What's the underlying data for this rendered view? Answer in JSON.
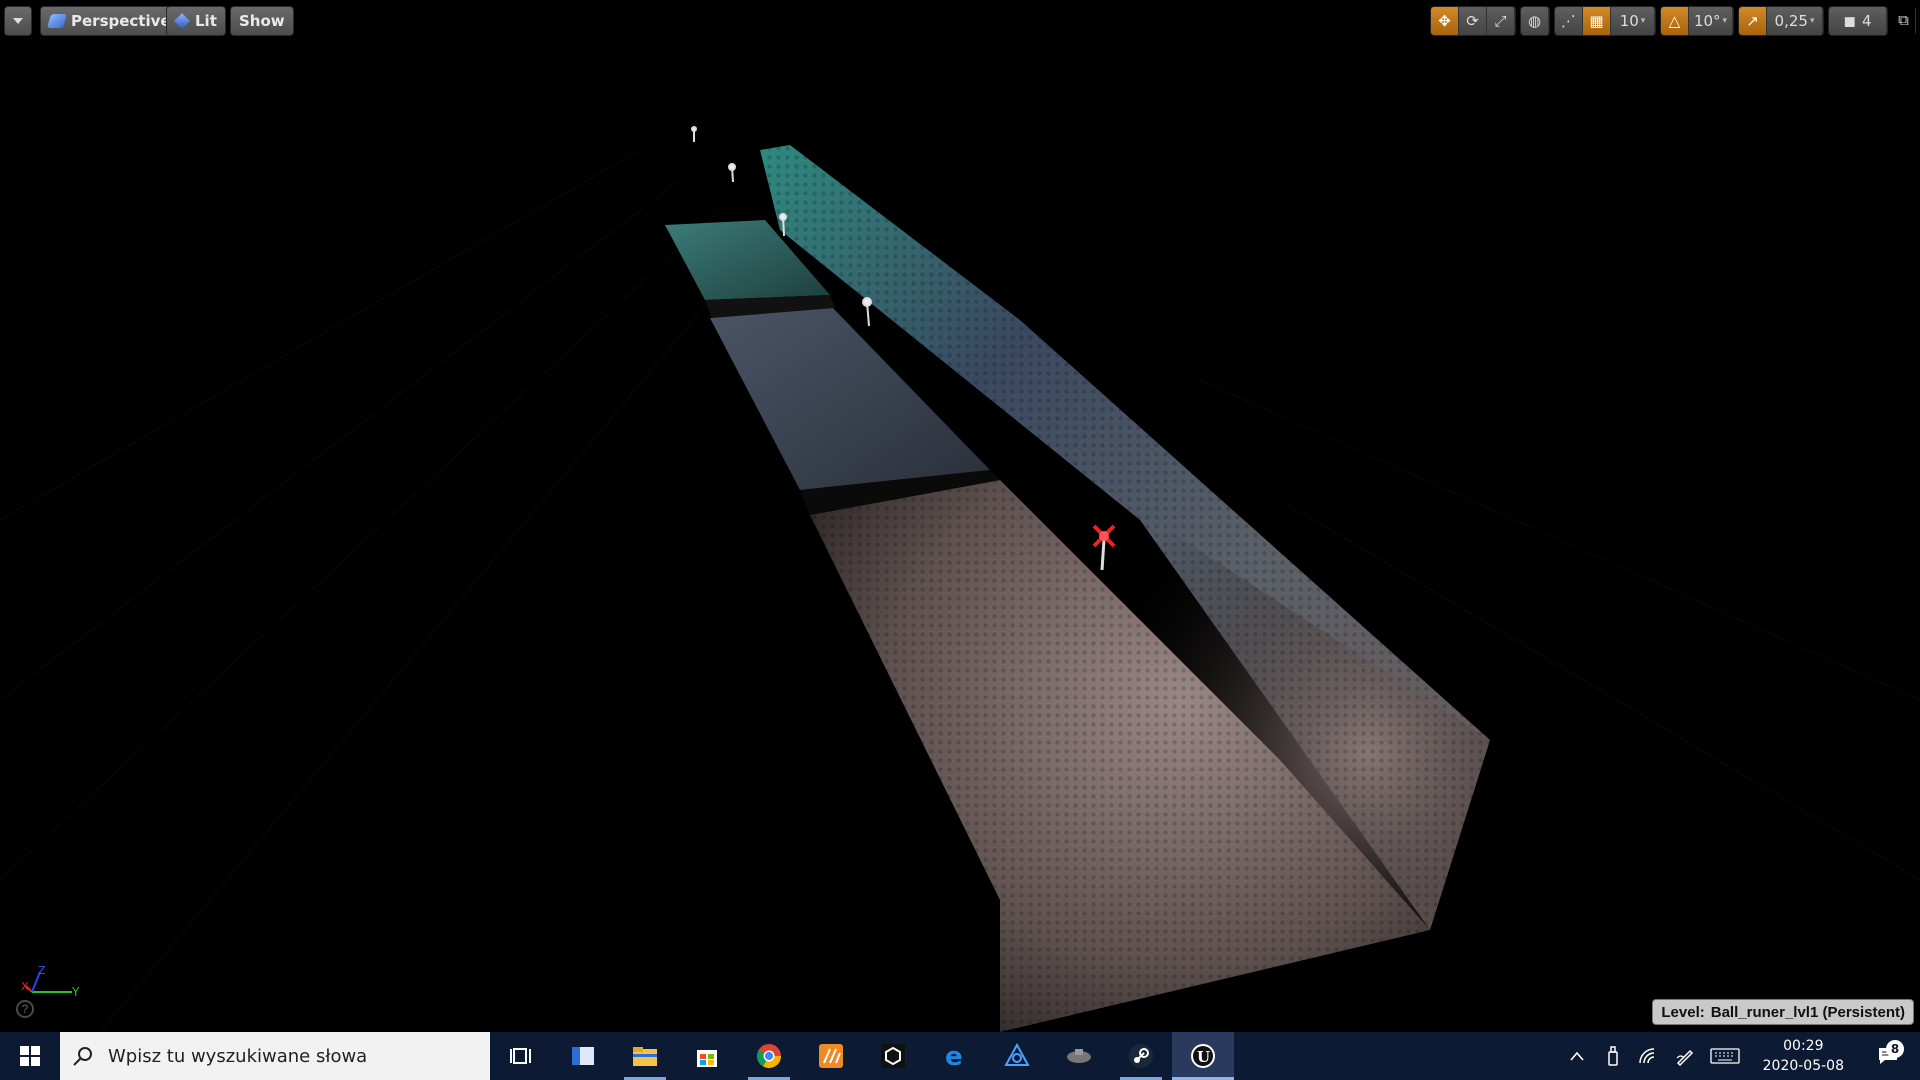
{
  "toolbar_left": {
    "menu_icon": "chevron-down-icon",
    "perspective_label": "Perspective",
    "lit_label": "Lit",
    "show_label": "Show"
  },
  "toolbar_right": {
    "grid_snap_value": "10",
    "rotation_snap_value": "10°",
    "scale_snap_value": "0,25",
    "camera_speed_value": "4"
  },
  "level": {
    "prefix": "Level:",
    "name": "Ball_runer_lvl1 (Persistent)"
  },
  "gizmo": {
    "z_label": "Z",
    "x_label": "X",
    "y_label": "Y",
    "help_glyph": "?"
  },
  "taskbar": {
    "search_placeholder": "Wpisz tu wyszukiwane słowa",
    "apps": [
      {
        "name": "task-view",
        "running": false
      },
      {
        "name": "app-window",
        "running": false
      },
      {
        "name": "file-explorer",
        "running": true
      },
      {
        "name": "microsoft-store",
        "running": false
      },
      {
        "name": "chrome",
        "running": true
      },
      {
        "name": "substance-app",
        "running": false
      },
      {
        "name": "unity",
        "running": false
      },
      {
        "name": "edge",
        "running": false
      },
      {
        "name": "blender-like-app",
        "running": false
      },
      {
        "name": "game-app",
        "running": false
      },
      {
        "name": "steam",
        "running": true
      },
      {
        "name": "unreal-engine",
        "running": true,
        "active": true
      }
    ],
    "time": "00:29",
    "date": "2020-05-08",
    "notification_count": "8"
  },
  "colors": {
    "accent_orange": "#c8791a",
    "taskbar_bg": "#0d1a33"
  }
}
